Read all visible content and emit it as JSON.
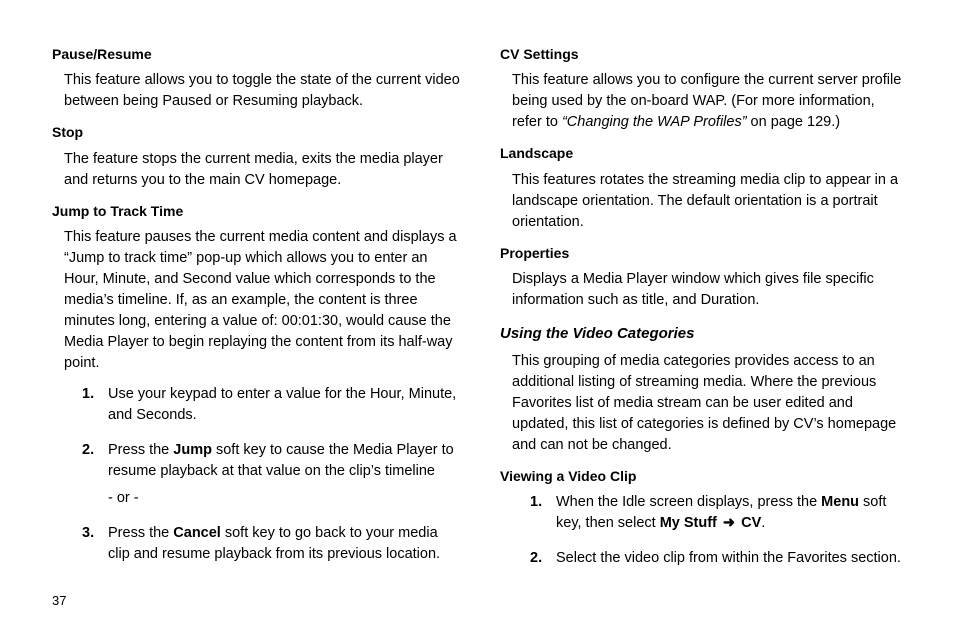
{
  "left": {
    "h_pause": "Pause/Resume",
    "p_pause": "This feature allows you to toggle the state of the current video between being Paused or Resuming playback.",
    "h_stop": "Stop",
    "p_stop": "The feature stops the current media, exits the media player and returns you to the main CV homepage.",
    "h_jump": "Jump to Track Time",
    "p_jump": "This feature pauses the current media content and displays a “Jump to track time” pop-up which allows you to enter an Hour, Minute, and Second value which corresponds to the media’s timeline. If, as an example, the content is three minutes long, entering a value of: 00:01:30, would cause the Media Player to begin replaying the content from its half-way point.",
    "step1": "Use your keypad to enter a value for the Hour, Minute, and Seconds.",
    "step2_pre": "Press the ",
    "step2_jump": "Jump",
    "step2_post": " soft key to cause the Media Player to resume playback at that value on the clip’s timeline",
    "step2_or": "- or -",
    "step3_pre": "Press the ",
    "step3_cancel": "Cancel",
    "step3_post": " soft key to go back to your media clip and resume playback from its previous location."
  },
  "right": {
    "h_cvset": "CV Settings",
    "p_cvset_a": "This feature allows you to configure the current server profile being used by the on-board WAP. (For more information, refer to ",
    "p_cvset_b": "“Changing the WAP Profiles”",
    "p_cvset_c": "  on page 129.)",
    "h_land": "Landscape",
    "p_land": "This features rotates the streaming media clip to appear in a landscape orientation. The default orientation is a portrait orientation.",
    "h_prop": "Properties",
    "p_prop": "Displays a Media Player window which gives file specific information such as title, and Duration.",
    "h_using": "Using the Video Categories",
    "p_using": "This grouping of media categories provides access to an additional listing of streaming media. Where the previous Favorites list of media stream can be user edited and updated, this list of categories is defined by CV’s homepage and can not be changed.",
    "h_view": "Viewing a Video Clip",
    "r_step1_a": "When the Idle screen displays, press the ",
    "r_step1_menu": "Menu",
    "r_step1_b": " soft key, then select ",
    "r_step1_mystuff": "My Stuff",
    "r_step1_arrow": "➜",
    "r_step1_cv": "CV",
    "r_step1_dot": ".",
    "r_step2": "Select the video clip from within the Favorites section."
  },
  "steps_num": {
    "n1": "1.",
    "n2": "2.",
    "n3": "3."
  },
  "page_number": "37"
}
